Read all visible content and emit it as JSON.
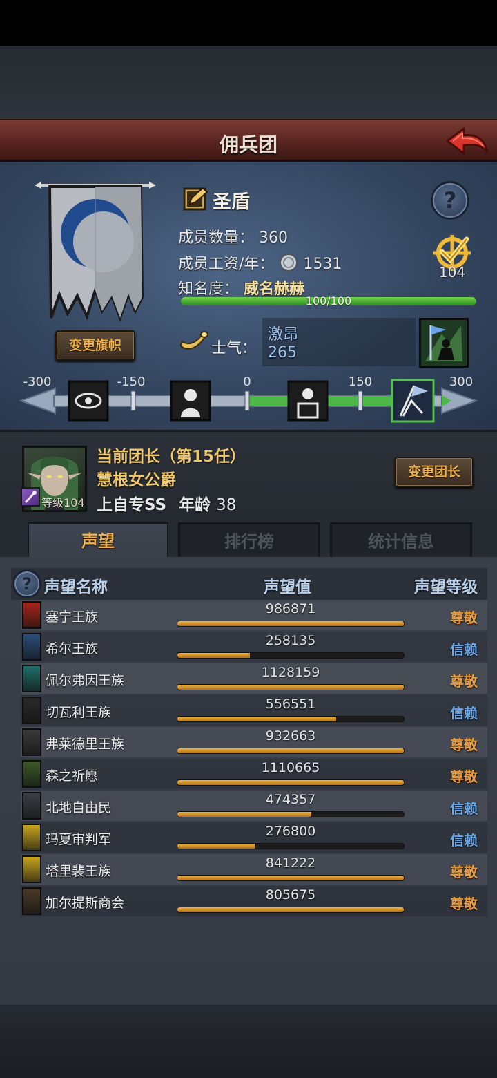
{
  "title": "佣兵团",
  "company": {
    "name": "圣盾",
    "members_label": "成员数量：",
    "members_value": "360",
    "salary_label": "成员工资/年：",
    "salary_value": "1531",
    "fame_label": "知名度：",
    "fame_value": "威名赫赫",
    "fame_progress_text": "100/100",
    "fame_progress": 1.0,
    "change_banner_label": "变更旗帜",
    "rank_value": "104",
    "morale_label": "士气：",
    "morale_word": "激昂",
    "morale_value": "265"
  },
  "morale_scale": {
    "ticks": [
      "-300",
      "-150",
      "0",
      "150",
      "300"
    ],
    "min": -300,
    "max": 300,
    "current": 265
  },
  "leader": {
    "title": "当前团长（第15任）",
    "name": "慧根女公爵",
    "level_text": "等级104",
    "specialty": "上自专SS",
    "age_label": "年龄",
    "age_value": "38",
    "change_button_label": "变更团长"
  },
  "tabs": [
    {
      "label": "声望",
      "active": true
    },
    {
      "label": "排行榜",
      "active": false
    },
    {
      "label": "统计信息",
      "active": false
    }
  ],
  "reputation": {
    "headers": {
      "name": "声望名称",
      "value": "声望值",
      "level": "声望等级"
    },
    "colors": {
      "revered": "#e89a3a",
      "trusted": "#6aa6e8"
    },
    "rows": [
      {
        "name": "塞宁王族",
        "value": "986871",
        "progress": 1.0,
        "level": "尊敬",
        "tier": "revered",
        "icon_color": "#a8251c"
      },
      {
        "name": "希尔王族",
        "value": "258135",
        "progress": 0.32,
        "level": "信赖",
        "tier": "trusted",
        "icon_color": "#2b4f7a"
      },
      {
        "name": "佩尔弗因王族",
        "value": "1128159",
        "progress": 1.0,
        "level": "尊敬",
        "tier": "revered",
        "icon_color": "#1f6e6a"
      },
      {
        "name": "切瓦利王族",
        "value": "556551",
        "progress": 0.7,
        "level": "信赖",
        "tier": "trusted",
        "icon_color": "#2a2a2a"
      },
      {
        "name": "弗莱德里王族",
        "value": "932663",
        "progress": 1.0,
        "level": "尊敬",
        "tier": "revered",
        "icon_color": "#3a3a3a"
      },
      {
        "name": "森之祈愿",
        "value": "1110665",
        "progress": 1.0,
        "level": "尊敬",
        "tier": "revered",
        "icon_color": "#3c5a2a"
      },
      {
        "name": "北地自由民",
        "value": "474357",
        "progress": 0.59,
        "level": "信赖",
        "tier": "trusted",
        "icon_color": "#3a3f45"
      },
      {
        "name": "玛夏审判军",
        "value": "276800",
        "progress": 0.34,
        "level": "信赖",
        "tier": "trusted",
        "icon_color": "#c9a51e"
      },
      {
        "name": "塔里裴王族",
        "value": "841222",
        "progress": 1.0,
        "level": "尊敬",
        "tier": "revered",
        "icon_color": "#c9a51e"
      },
      {
        "name": "加尔提斯商会",
        "value": "805675",
        "progress": 1.0,
        "level": "尊敬",
        "tier": "revered",
        "icon_color": "#4a3a28"
      }
    ]
  }
}
